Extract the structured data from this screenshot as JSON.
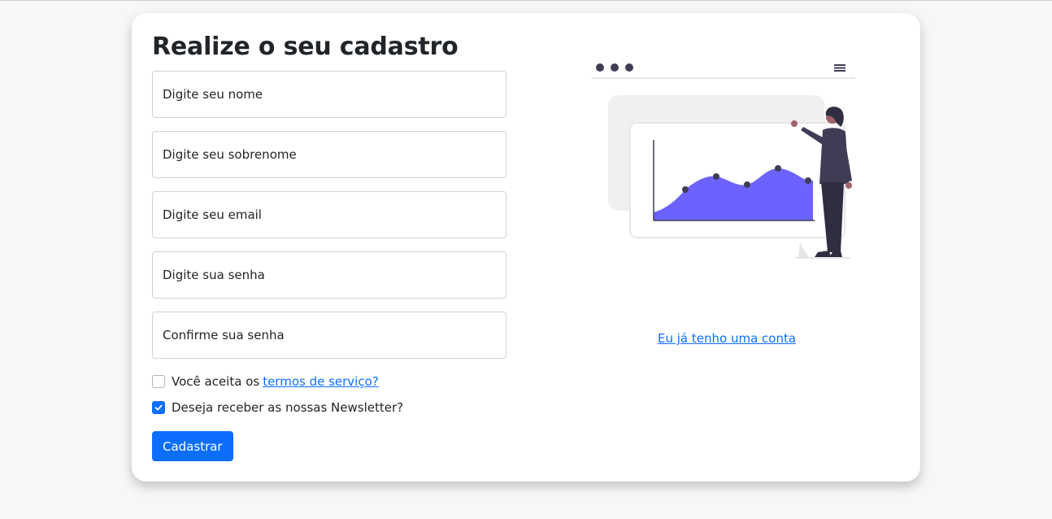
{
  "form": {
    "title": "Realize o seu cadastro",
    "fields": [
      {
        "name": "first-name-input",
        "placeholder": "Digite seu nome",
        "value": ""
      },
      {
        "name": "last-name-input",
        "placeholder": "Digite seu sobrenome",
        "value": ""
      },
      {
        "name": "email-input",
        "placeholder": "Digite seu email",
        "value": ""
      },
      {
        "name": "password-input",
        "placeholder": "Digite sua senha",
        "value": ""
      },
      {
        "name": "confirm-password-input",
        "placeholder": "Confirme sua senha",
        "value": ""
      }
    ],
    "terms": {
      "prefix": "Você aceita os",
      "link": "termos de serviço?",
      "checked": false
    },
    "newsletter": {
      "label": "Deseja receber as nossas Newsletter?",
      "checked": true
    },
    "submit_label": "Cadastrar"
  },
  "side": {
    "illustration_icon": "data-chart-presentation-illustration",
    "login_link": "Eu já tenho uma conta"
  },
  "colors": {
    "accent": "#0d6efd",
    "chart_fill": "#6c63ff",
    "dark": "#3f3d56",
    "background": "#f7f7f7"
  }
}
